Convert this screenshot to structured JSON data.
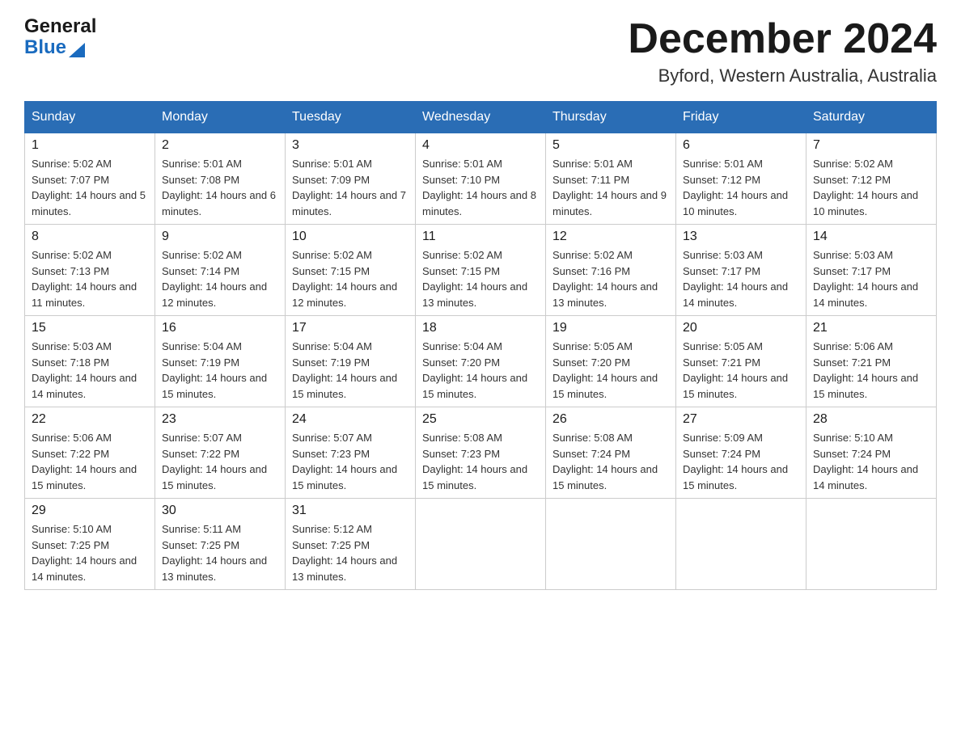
{
  "logo": {
    "text1": "General",
    "text2": "Blue"
  },
  "title": "December 2024",
  "location": "Byford, Western Australia, Australia",
  "weekdays": [
    "Sunday",
    "Monday",
    "Tuesday",
    "Wednesday",
    "Thursday",
    "Friday",
    "Saturday"
  ],
  "weeks": [
    [
      {
        "day": "1",
        "sunrise": "5:02 AM",
        "sunset": "7:07 PM",
        "daylight": "14 hours and 5 minutes."
      },
      {
        "day": "2",
        "sunrise": "5:01 AM",
        "sunset": "7:08 PM",
        "daylight": "14 hours and 6 minutes."
      },
      {
        "day": "3",
        "sunrise": "5:01 AM",
        "sunset": "7:09 PM",
        "daylight": "14 hours and 7 minutes."
      },
      {
        "day": "4",
        "sunrise": "5:01 AM",
        "sunset": "7:10 PM",
        "daylight": "14 hours and 8 minutes."
      },
      {
        "day": "5",
        "sunrise": "5:01 AM",
        "sunset": "7:11 PM",
        "daylight": "14 hours and 9 minutes."
      },
      {
        "day": "6",
        "sunrise": "5:01 AM",
        "sunset": "7:12 PM",
        "daylight": "14 hours and 10 minutes."
      },
      {
        "day": "7",
        "sunrise": "5:02 AM",
        "sunset": "7:12 PM",
        "daylight": "14 hours and 10 minutes."
      }
    ],
    [
      {
        "day": "8",
        "sunrise": "5:02 AM",
        "sunset": "7:13 PM",
        "daylight": "14 hours and 11 minutes."
      },
      {
        "day": "9",
        "sunrise": "5:02 AM",
        "sunset": "7:14 PM",
        "daylight": "14 hours and 12 minutes."
      },
      {
        "day": "10",
        "sunrise": "5:02 AM",
        "sunset": "7:15 PM",
        "daylight": "14 hours and 12 minutes."
      },
      {
        "day": "11",
        "sunrise": "5:02 AM",
        "sunset": "7:15 PM",
        "daylight": "14 hours and 13 minutes."
      },
      {
        "day": "12",
        "sunrise": "5:02 AM",
        "sunset": "7:16 PM",
        "daylight": "14 hours and 13 minutes."
      },
      {
        "day": "13",
        "sunrise": "5:03 AM",
        "sunset": "7:17 PM",
        "daylight": "14 hours and 14 minutes."
      },
      {
        "day": "14",
        "sunrise": "5:03 AM",
        "sunset": "7:17 PM",
        "daylight": "14 hours and 14 minutes."
      }
    ],
    [
      {
        "day": "15",
        "sunrise": "5:03 AM",
        "sunset": "7:18 PM",
        "daylight": "14 hours and 14 minutes."
      },
      {
        "day": "16",
        "sunrise": "5:04 AM",
        "sunset": "7:19 PM",
        "daylight": "14 hours and 15 minutes."
      },
      {
        "day": "17",
        "sunrise": "5:04 AM",
        "sunset": "7:19 PM",
        "daylight": "14 hours and 15 minutes."
      },
      {
        "day": "18",
        "sunrise": "5:04 AM",
        "sunset": "7:20 PM",
        "daylight": "14 hours and 15 minutes."
      },
      {
        "day": "19",
        "sunrise": "5:05 AM",
        "sunset": "7:20 PM",
        "daylight": "14 hours and 15 minutes."
      },
      {
        "day": "20",
        "sunrise": "5:05 AM",
        "sunset": "7:21 PM",
        "daylight": "14 hours and 15 minutes."
      },
      {
        "day": "21",
        "sunrise": "5:06 AM",
        "sunset": "7:21 PM",
        "daylight": "14 hours and 15 minutes."
      }
    ],
    [
      {
        "day": "22",
        "sunrise": "5:06 AM",
        "sunset": "7:22 PM",
        "daylight": "14 hours and 15 minutes."
      },
      {
        "day": "23",
        "sunrise": "5:07 AM",
        "sunset": "7:22 PM",
        "daylight": "14 hours and 15 minutes."
      },
      {
        "day": "24",
        "sunrise": "5:07 AM",
        "sunset": "7:23 PM",
        "daylight": "14 hours and 15 minutes."
      },
      {
        "day": "25",
        "sunrise": "5:08 AM",
        "sunset": "7:23 PM",
        "daylight": "14 hours and 15 minutes."
      },
      {
        "day": "26",
        "sunrise": "5:08 AM",
        "sunset": "7:24 PM",
        "daylight": "14 hours and 15 minutes."
      },
      {
        "day": "27",
        "sunrise": "5:09 AM",
        "sunset": "7:24 PM",
        "daylight": "14 hours and 15 minutes."
      },
      {
        "day": "28",
        "sunrise": "5:10 AM",
        "sunset": "7:24 PM",
        "daylight": "14 hours and 14 minutes."
      }
    ],
    [
      {
        "day": "29",
        "sunrise": "5:10 AM",
        "sunset": "7:25 PM",
        "daylight": "14 hours and 14 minutes."
      },
      {
        "day": "30",
        "sunrise": "5:11 AM",
        "sunset": "7:25 PM",
        "daylight": "14 hours and 13 minutes."
      },
      {
        "day": "31",
        "sunrise": "5:12 AM",
        "sunset": "7:25 PM",
        "daylight": "14 hours and 13 minutes."
      },
      null,
      null,
      null,
      null
    ]
  ]
}
